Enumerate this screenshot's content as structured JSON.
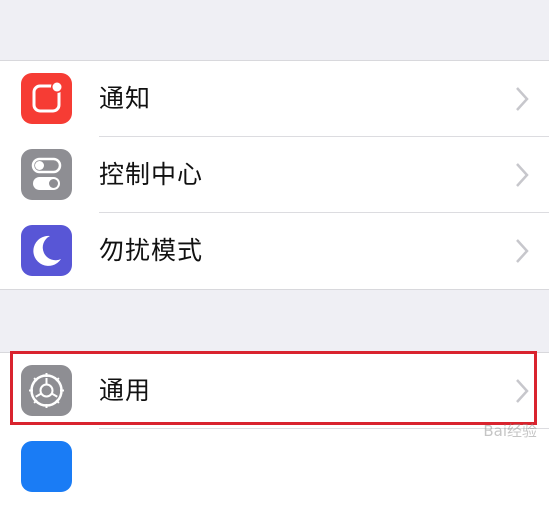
{
  "group1": {
    "items": [
      {
        "label": "通知",
        "icon": "notifications-icon",
        "color": "#f63c34"
      },
      {
        "label": "控制中心",
        "icon": "control-center-icon",
        "color": "#8e8e93"
      },
      {
        "label": "勿扰模式",
        "icon": "do-not-disturb-moon-icon",
        "color": "#5856d6"
      }
    ]
  },
  "group2": {
    "items": [
      {
        "label": "通用",
        "icon": "gear-icon",
        "color": "#8e8e93"
      },
      {
        "label": "",
        "icon": "display-brightness-icon",
        "color": "#1a7cf5"
      }
    ]
  },
  "highlight_color": "#d9232e",
  "watermark": "Bai经验"
}
